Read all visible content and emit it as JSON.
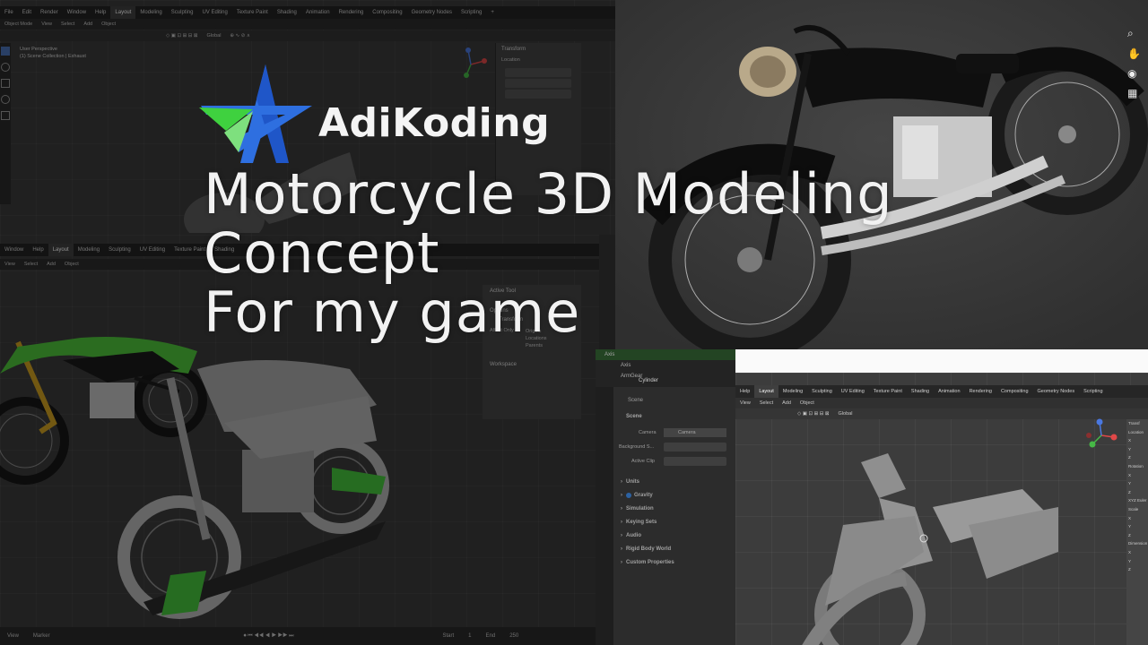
{
  "brand": {
    "name": "AdiKoding"
  },
  "headline": {
    "line1": "Motorcycle 3D Modeling",
    "line2": "Concept",
    "line3": "For my game"
  },
  "window1": {
    "menu": [
      "File",
      "Edit",
      "Render",
      "Window",
      "Help"
    ],
    "workspaces": [
      "Layout",
      "Modeling",
      "Sculpting",
      "UV Editing",
      "Texture Paint",
      "Shading",
      "Animation",
      "Rendering",
      "Compositing",
      "Geometry Nodes",
      "Scripting"
    ],
    "header": [
      "Object Mode",
      "View",
      "Select",
      "Add",
      "Object"
    ],
    "transform": "Global",
    "viewport_info": [
      "User Perspective",
      "(1) Scene Collection | Exhaust"
    ],
    "sidebar_title": "Transform",
    "location_label": "Location"
  },
  "window2": {
    "menu": [
      "Window",
      "Help"
    ],
    "workspaces": [
      "Layout",
      "Modeling",
      "Sculpting",
      "UV Editing",
      "Texture Paint",
      "Shading"
    ],
    "header": [
      "View",
      "Select",
      "Add",
      "Object"
    ],
    "tool_title": "Active Tool",
    "options_label": "Options",
    "transform_label": "Transform",
    "affect_only": "Affect Only",
    "affect_options": [
      "Origins",
      "Locations",
      "Parents"
    ],
    "workspace_label": "Workspace",
    "timeline": [
      "View",
      "Marker",
      "Start",
      "1",
      "End",
      "250"
    ]
  },
  "window3": {
    "workspaces": [
      "Help",
      "Layout",
      "Modeling",
      "Sculpting",
      "UV Editing",
      "Texture Paint",
      "Shading",
      "Animation",
      "Rendering",
      "Compositing",
      "Geometry Nodes",
      "Scripting"
    ],
    "header": [
      "View",
      "Select",
      "Add",
      "Object"
    ],
    "transform": "Global",
    "outliner": [
      "Axis",
      "Axis",
      "ArmGear",
      "Cylinder"
    ],
    "properties_title": "Scene",
    "scene_section": "Scene",
    "camera_label": "Camera",
    "camera_value": "Camera",
    "background_label": "Background S...",
    "clip_label": "Active Clip",
    "sections": [
      "Units",
      "Gravity",
      "Simulation",
      "Keying Sets",
      "Audio",
      "Rigid Body World",
      "Custom Properties"
    ],
    "sidebar": [
      "Transf",
      "Location",
      "X",
      "Y",
      "Z",
      "Rotation",
      "X",
      "Y",
      "Z",
      "XYZ Euler",
      "Scale",
      "X",
      "Y",
      "Z",
      "Dimension",
      "X",
      "Y",
      "Z"
    ]
  },
  "colors": {
    "accent_blue": "#2e6fe0",
    "accent_green": "#3fd13f",
    "kawasaki_green": "#4fc43a",
    "brand_text": "#f4f4f4"
  }
}
